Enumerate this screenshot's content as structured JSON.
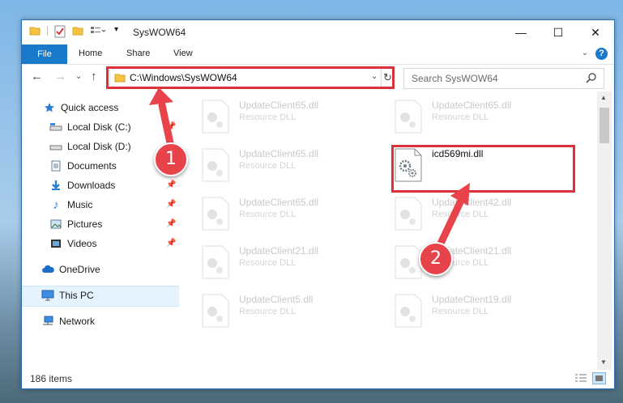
{
  "window": {
    "title": "SysWOW64",
    "minimize_glyph": "—",
    "maximize_glyph": "☐",
    "close_glyph": "✕"
  },
  "ribbon": {
    "tabs": [
      "File",
      "Home",
      "Share",
      "View"
    ],
    "help_glyph": "?"
  },
  "nav": {
    "address": "C:\\Windows\\SysWOW64",
    "search_placeholder": "Search SysWOW64"
  },
  "sidebar": {
    "items": [
      {
        "label": "Quick access",
        "icon": "star-icon",
        "pinned": false
      },
      {
        "label": "Local Disk (C:)",
        "icon": "drive-icon",
        "pinned": true
      },
      {
        "label": "Local Disk (D:)",
        "icon": "drive-icon",
        "pinned": false
      },
      {
        "label": "Documents",
        "icon": "documents-icon",
        "pinned": true
      },
      {
        "label": "Downloads",
        "icon": "download-icon",
        "pinned": true
      },
      {
        "label": "Music",
        "icon": "music-icon",
        "pinned": true
      },
      {
        "label": "Pictures",
        "icon": "pictures-icon",
        "pinned": true
      },
      {
        "label": "Videos",
        "icon": "videos-icon",
        "pinned": true
      },
      {
        "label": "OneDrive",
        "icon": "cloud-icon",
        "pinned": false
      },
      {
        "label": "This PC",
        "icon": "computer-icon",
        "pinned": false,
        "selected": true
      },
      {
        "label": "Network",
        "icon": "network-icon",
        "pinned": false
      }
    ]
  },
  "files": [
    {
      "name": "UpdateClient65.dll",
      "type": "Resource DLL"
    },
    {
      "name": "UpdateClient65.dll",
      "type": "Resource DLL"
    },
    {
      "name": "UpdateClient65.dll",
      "type": "Resource DLL"
    },
    {
      "name": "icd569mi.dll",
      "type": ""
    },
    {
      "name": "UpdateClient65.dll",
      "type": "Resource DLL"
    },
    {
      "name": "UpdateClient42.dll",
      "type": "Resource DLL"
    },
    {
      "name": "UpdateClient21.dll",
      "type": "Resource DLL"
    },
    {
      "name": "UpdateClient21.dll",
      "type": "Resource DLL"
    },
    {
      "name": "UpdateClient5.dll",
      "type": "Resource DLL"
    },
    {
      "name": "UpdateClient19.dll",
      "type": "Resource DLL"
    }
  ],
  "status": {
    "item_count": "186 items"
  },
  "annotations": {
    "step1": "1",
    "step2": "2",
    "color": "#e8434b"
  }
}
